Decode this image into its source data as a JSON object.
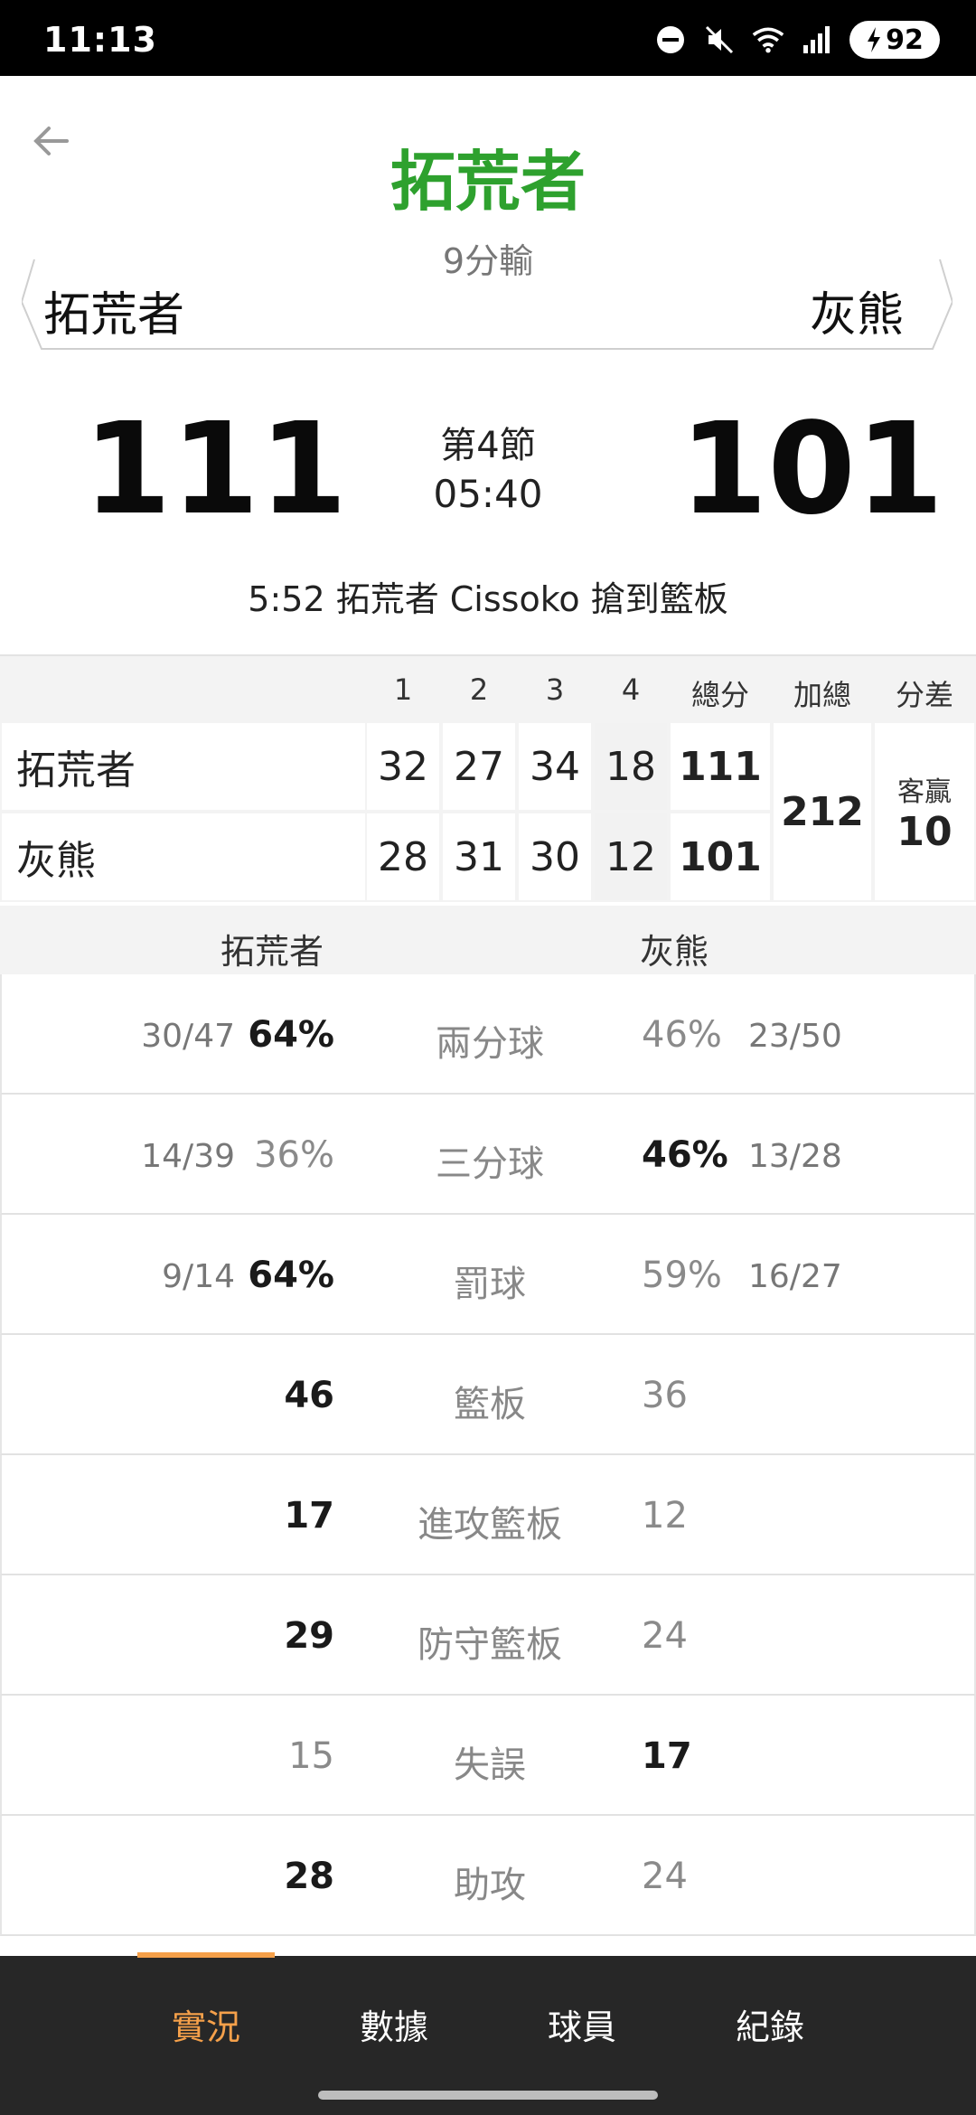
{
  "status_bar": {
    "time": "11:13",
    "battery": "92"
  },
  "header": {
    "winner_team": "拓荒者",
    "margin_text": "9分輸",
    "home_team": "拓荒者",
    "away_team": "灰熊"
  },
  "scoreboard": {
    "home_score": "111",
    "away_score": "101",
    "period": "第4節",
    "clock": "05:40",
    "last_play": "5:52 拓荒者 Cissoko 搶到籃板"
  },
  "quarters": {
    "headers": [
      "1",
      "2",
      "3",
      "4",
      "總分",
      "加總",
      "分差"
    ],
    "rows": [
      {
        "team": "拓荒者",
        "q": [
          "32",
          "27",
          "34",
          "18"
        ],
        "total": "111"
      },
      {
        "team": "灰熊",
        "q": [
          "28",
          "31",
          "30",
          "12"
        ],
        "total": "101"
      }
    ],
    "sum": "212",
    "diff_label": "客贏",
    "diff_value": "10"
  },
  "stats": {
    "home_label": "拓荒者",
    "away_label": "灰熊",
    "rows": [
      {
        "label": "兩分球",
        "home_frac": "30/47",
        "home_val": "64%",
        "away_val": "46%",
        "away_frac": "23/50",
        "lead": "home"
      },
      {
        "label": "三分球",
        "home_frac": "14/39",
        "home_val": "36%",
        "away_val": "46%",
        "away_frac": "13/28",
        "lead": "away"
      },
      {
        "label": "罰球",
        "home_frac": "9/14",
        "home_val": "64%",
        "away_val": "59%",
        "away_frac": "16/27",
        "lead": "home"
      },
      {
        "label": "籃板",
        "home_frac": "",
        "home_val": "46",
        "away_val": "36",
        "away_frac": "",
        "lead": "home"
      },
      {
        "label": "進攻籃板",
        "home_frac": "",
        "home_val": "17",
        "away_val": "12",
        "away_frac": "",
        "lead": "home"
      },
      {
        "label": "防守籃板",
        "home_frac": "",
        "home_val": "29",
        "away_val": "24",
        "away_frac": "",
        "lead": "home"
      },
      {
        "label": "失誤",
        "home_frac": "",
        "home_val": "15",
        "away_val": "17",
        "away_frac": "",
        "lead": "away"
      },
      {
        "label": "助攻",
        "home_frac": "",
        "home_val": "28",
        "away_val": "24",
        "away_frac": "",
        "lead": "home"
      }
    ]
  },
  "bottom_nav": {
    "tabs": [
      "實況",
      "數據",
      "球員",
      "紀錄"
    ],
    "active": "實況"
  },
  "colors": {
    "winner": "#2ea12e",
    "accent": "#f5a04a",
    "nav_bg": "#272727"
  },
  "icons": [
    "back-arrow-icon",
    "dnd-icon",
    "mute-icon",
    "wifi-icon",
    "signal-icon",
    "charging-icon"
  ]
}
